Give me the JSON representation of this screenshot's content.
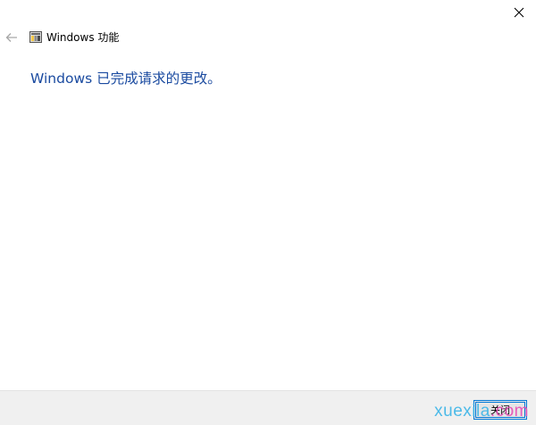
{
  "window": {
    "title": "Windows 功能",
    "close_glyph": "✕",
    "back_glyph": "←"
  },
  "main": {
    "status_message": "Windows 已完成请求的更改。"
  },
  "footer": {
    "close_label": "关闭"
  },
  "watermark": {
    "part1": "xuexila",
    "part2": ".com"
  },
  "icons": {
    "close": "close-icon",
    "back": "back-arrow-icon",
    "app": "windows-features-icon"
  },
  "colors": {
    "accent": "#0078d7",
    "status_text": "#1b4ba0",
    "footer_bg": "#f0f0f0"
  }
}
